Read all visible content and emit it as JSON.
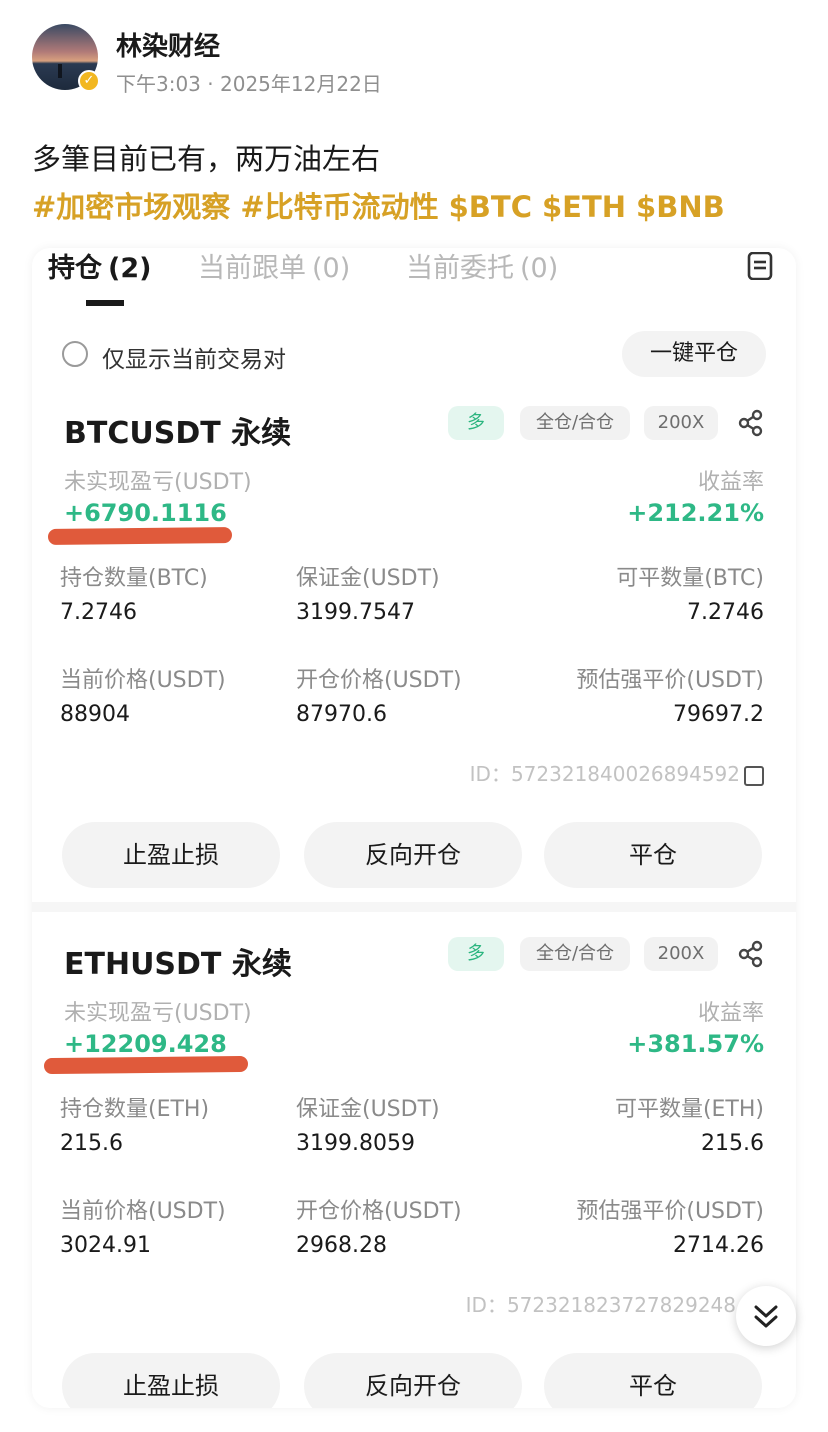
{
  "post": {
    "author": "林染财经",
    "time": "下午3:03",
    "date": "2025年12月22日",
    "text": "多筆目前已有，两万油左右",
    "tags": [
      "#加密市场观察",
      "#比特币流动性",
      "$BTC",
      "$ETH",
      "$BNB"
    ]
  },
  "tabs": [
    {
      "label": "持仓",
      "count": "(2)"
    },
    {
      "label": "当前跟单",
      "count": "(0)"
    },
    {
      "label": "当前委托",
      "count": "(0)"
    }
  ],
  "filter_label": "仅显示当前交易对",
  "close_all_label": "一键平仓",
  "labels": {
    "unrealized_pnl": "未实现盈亏(USDT)",
    "roe": "收益率",
    "margin": "保证金(USDT)",
    "current_price": "当前价格(USDT)",
    "entry_price": "开仓价格(USDT)",
    "liq_price": "预估强平价(USDT)",
    "id_prefix": "ID："
  },
  "buttons": {
    "tp_sl": "止盈止损",
    "reverse": "反向开仓",
    "close": "平仓"
  },
  "colors": {
    "profit": "#2eb886",
    "tag": "#d7a125",
    "highlight": "#e05a3b"
  },
  "positions": [
    {
      "symbol": "BTCUSDT 永续",
      "side": "多",
      "margin_mode": "全仓/合仓",
      "leverage": "200X",
      "pnl": "+6790.1116",
      "roe": "+212.21%",
      "size_label": "持仓数量(BTC)",
      "size": "7.2746",
      "margin": "3199.7547",
      "closable_label": "可平数量(BTC)",
      "closable": "7.2746",
      "current_price": "88904",
      "entry_price": "87970.6",
      "liq_price": "79697.2",
      "id": "572321840026894592"
    },
    {
      "symbol": "ETHUSDT 永续",
      "side": "多",
      "margin_mode": "全仓/合仓",
      "leverage": "200X",
      "pnl": "+12209.428",
      "roe": "+381.57%",
      "size_label": "持仓数量(ETH)",
      "size": "215.6",
      "margin": "3199.8059",
      "closable_label": "可平数量(ETH)",
      "closable": "215.6",
      "current_price": "3024.91",
      "entry_price": "2968.28",
      "liq_price": "2714.26",
      "id": "572321823727829248"
    }
  ]
}
